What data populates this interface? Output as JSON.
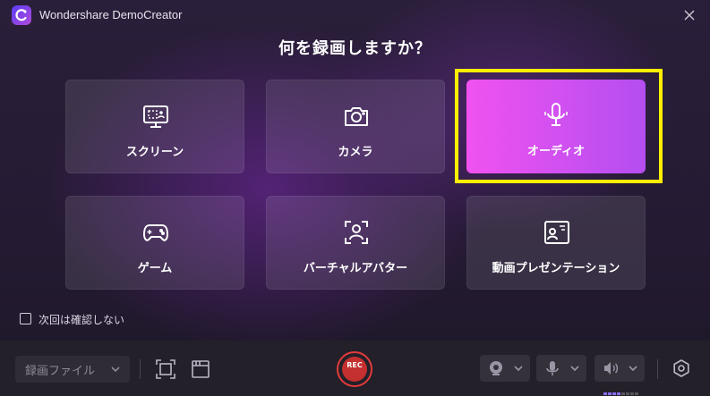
{
  "window": {
    "title": "Wondershare DemoCreator"
  },
  "heading": "何を録画しますか？",
  "tiles": [
    {
      "label": "スクリーン",
      "icon": "screen-record-icon"
    },
    {
      "label": "カメラ",
      "icon": "camera-icon"
    },
    {
      "label": "オーディオ",
      "icon": "microphone-icon",
      "selected": true
    },
    {
      "label": "ゲーム",
      "icon": "gamepad-icon"
    },
    {
      "label": "バーチャルアバター",
      "icon": "avatar-icon"
    },
    {
      "label": "動画プレゼンテーション",
      "icon": "presentation-icon"
    }
  ],
  "options": {
    "dont_show_again": "次回は確認しない"
  },
  "toolbar": {
    "record_file_placeholder": "録画ファイル",
    "rec_label": "REC"
  },
  "colors": {
    "accent_start": "#f052f0",
    "accent_end": "#b44ef0",
    "rec": "#c42f2f",
    "highlight": "#ffee00"
  }
}
